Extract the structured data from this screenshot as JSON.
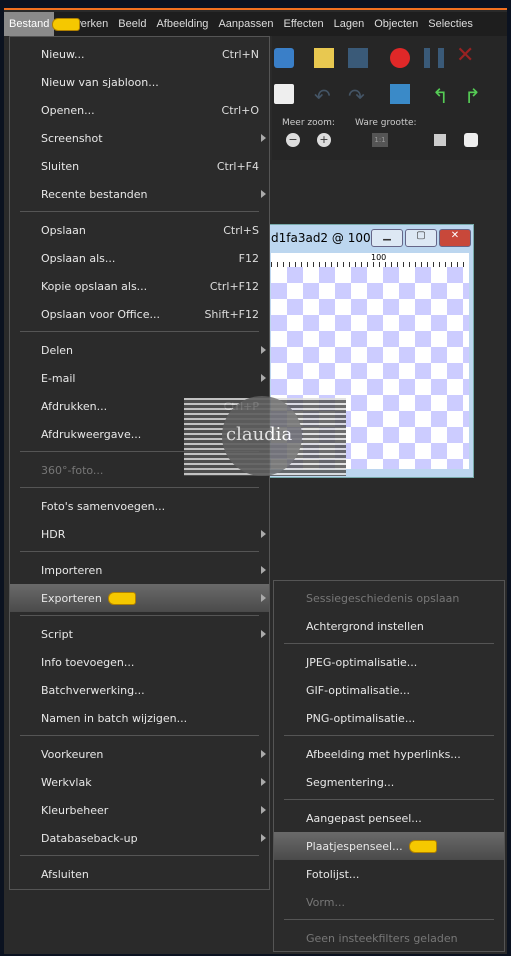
{
  "menubar": [
    "Bestand",
    "Bewerken",
    "Beeld",
    "Afbeelding",
    "Aanpassen",
    "Effecten",
    "Lagen",
    "Objecten",
    "Selecties"
  ],
  "toolbar": {
    "zoom_more": "Meer zoom:",
    "actual_size": "Ware grootte:",
    "actual_size_btn": "1:1"
  },
  "document": {
    "title": "d1fa3ad2 @ 100...",
    "ruler_mark": "100"
  },
  "watermark": "claudia",
  "main_menu": [
    {
      "label": "Nieuw...",
      "shortcut": "Ctrl+N"
    },
    {
      "label": "Nieuw van sjabloon..."
    },
    {
      "label": "Openen...",
      "shortcut": "Ctrl+O"
    },
    {
      "label": "Screenshot",
      "submenu": true
    },
    {
      "label": "Sluiten",
      "shortcut": "Ctrl+F4"
    },
    {
      "label": "Recente bestanden",
      "submenu": true
    },
    {
      "sep": true
    },
    {
      "label": "Opslaan",
      "shortcut": "Ctrl+S"
    },
    {
      "label": "Opslaan als...",
      "shortcut": "F12"
    },
    {
      "label": "Kopie opslaan als...",
      "shortcut": "Ctrl+F12"
    },
    {
      "label": "Opslaan voor Office...",
      "shortcut": "Shift+F12"
    },
    {
      "sep": true
    },
    {
      "label": "Delen",
      "submenu": true
    },
    {
      "label": "E-mail",
      "submenu": true
    },
    {
      "label": "Afdrukken...",
      "shortcut": "Ctrl+P"
    },
    {
      "label": "Afdrukweergave..."
    },
    {
      "sep": true
    },
    {
      "label": "360°-foto...",
      "disabled": true
    },
    {
      "sep": true
    },
    {
      "label": "Foto's samenvoegen..."
    },
    {
      "label": "HDR",
      "submenu": true
    },
    {
      "sep": true
    },
    {
      "label": "Importeren",
      "submenu": true
    },
    {
      "label": "Exporteren",
      "submenu": true,
      "highlighted": true
    },
    {
      "sep": true
    },
    {
      "label": "Script",
      "submenu": true
    },
    {
      "label": "Info toevoegen..."
    },
    {
      "label": "Batchverwerking..."
    },
    {
      "label": "Namen in batch wijzigen..."
    },
    {
      "sep": true
    },
    {
      "label": "Voorkeuren",
      "submenu": true
    },
    {
      "label": "Werkvlak",
      "submenu": true
    },
    {
      "label": "Kleurbeheer",
      "submenu": true
    },
    {
      "label": "Databaseback-up",
      "submenu": true
    },
    {
      "sep": true
    },
    {
      "label": "Afsluiten"
    }
  ],
  "export_menu": [
    {
      "label": "Sessiegeschiedenis opslaan",
      "disabled": true
    },
    {
      "label": "Achtergrond instellen"
    },
    {
      "sep": true
    },
    {
      "label": "JPEG-optimalisatie..."
    },
    {
      "label": "GIF-optimalisatie..."
    },
    {
      "label": "PNG-optimalisatie..."
    },
    {
      "sep": true
    },
    {
      "label": "Afbeelding met hyperlinks..."
    },
    {
      "label": "Segmentering..."
    },
    {
      "sep": true
    },
    {
      "label": "Aangepast penseel..."
    },
    {
      "label": "Plaatjespenseel...",
      "highlighted": true
    },
    {
      "label": "Fotolijst..."
    },
    {
      "label": "Vorm...",
      "disabled": true
    },
    {
      "sep": true
    },
    {
      "label": "Geen insteekfilters geladen",
      "disabled": true
    }
  ]
}
